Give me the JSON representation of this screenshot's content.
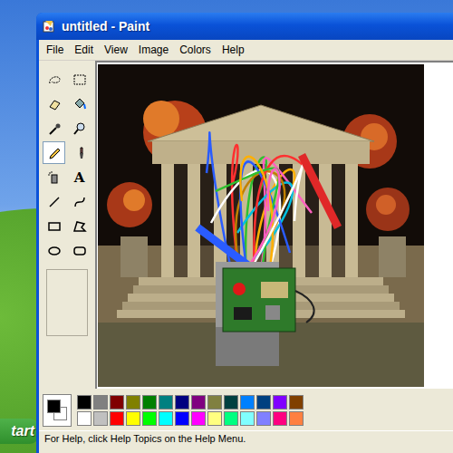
{
  "window": {
    "title": "untitled - Paint"
  },
  "menu": [
    "File",
    "Edit",
    "View",
    "Image",
    "Colors",
    "Help"
  ],
  "tools": [
    {
      "kind": "lasso",
      "selected": false
    },
    {
      "kind": "select",
      "selected": false
    },
    {
      "kind": "eraser",
      "selected": false
    },
    {
      "kind": "fill",
      "selected": false
    },
    {
      "kind": "picker",
      "selected": false
    },
    {
      "kind": "magnifier",
      "selected": false
    },
    {
      "kind": "pencil",
      "selected": true
    },
    {
      "kind": "brush",
      "selected": false
    },
    {
      "kind": "airbrush",
      "selected": false
    },
    {
      "kind": "text",
      "selected": false,
      "glyph": "A"
    },
    {
      "kind": "line",
      "selected": false
    },
    {
      "kind": "curve",
      "selected": false
    },
    {
      "kind": "rectangle",
      "selected": false
    },
    {
      "kind": "polygon",
      "selected": false
    },
    {
      "kind": "ellipse",
      "selected": false
    },
    {
      "kind": "rounded",
      "selected": false
    }
  ],
  "colors": {
    "foreground": "#000000",
    "background": "#ffffff"
  },
  "palette": [
    {
      "color": "#000000"
    },
    {
      "color": "#808080"
    },
    {
      "color": "#800000"
    },
    {
      "color": "#808000"
    },
    {
      "color": "#008000"
    },
    {
      "color": "#008080"
    },
    {
      "color": "#000080"
    },
    {
      "color": "#800080"
    },
    {
      "color": "#808040"
    },
    {
      "color": "#004040"
    },
    {
      "color": "#0080ff"
    },
    {
      "color": "#004080"
    },
    {
      "color": "#8000ff"
    },
    {
      "color": "#804000"
    },
    {
      "color": "#ffffff"
    },
    {
      "color": "#c0c0c0"
    },
    {
      "color": "#ff0000"
    },
    {
      "color": "#ffff00"
    },
    {
      "color": "#00ff00"
    },
    {
      "color": "#00ffff"
    },
    {
      "color": "#0000ff"
    },
    {
      "color": "#ff00ff"
    },
    {
      "color": "#ffff80"
    },
    {
      "color": "#00ff80"
    },
    {
      "color": "#80ffff"
    },
    {
      "color": "#8080ff"
    },
    {
      "color": "#ff0080"
    },
    {
      "color": "#ff8040"
    }
  ],
  "status_bar": "For Help, click Help Topics on the Help Menu.",
  "taskbar": {
    "start": "tart"
  }
}
